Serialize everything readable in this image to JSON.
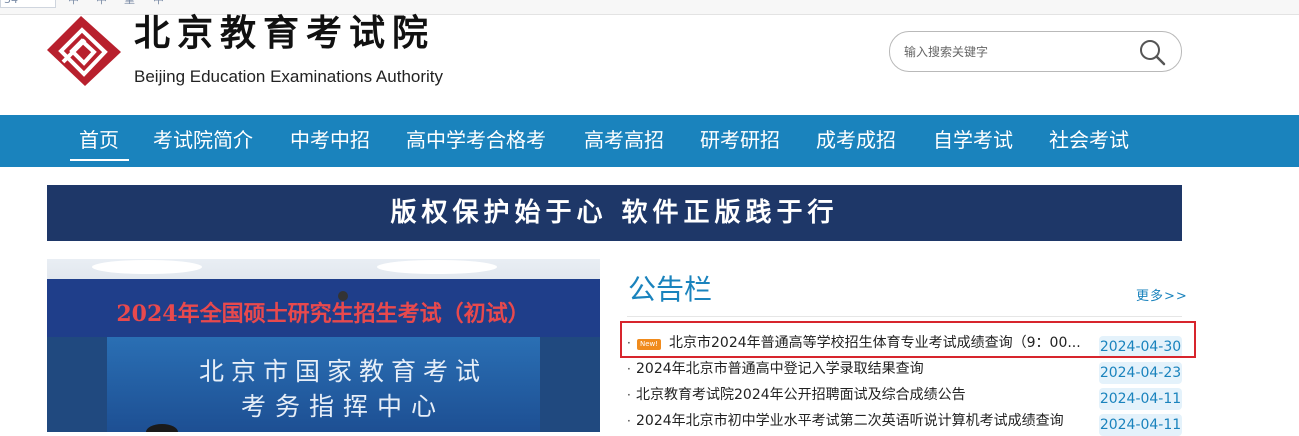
{
  "topbar": {
    "items": [
      "34",
      "中",
      "中",
      "重",
      "中"
    ]
  },
  "header": {
    "org_name_cn": "北京教育考试院",
    "org_name_en": "Beijing Education Examinations Authority",
    "logo_icon": "beaa-logo-icon"
  },
  "search": {
    "placeholder": "输入搜索关键字",
    "value": "",
    "icon": "search-icon"
  },
  "nav": {
    "items": [
      "首页",
      "考试院简介",
      "中考中招",
      "高中学考合格考",
      "高考高招",
      "研考研招",
      "成考成招",
      "自学考试",
      "社会考试"
    ],
    "active_index": 0
  },
  "banner": {
    "text": "版权保护始于心 软件正版践于行"
  },
  "photo": {
    "headline": "2024年全国硕士研究生招生考试（初试）",
    "sign_line1": "北京市国家教育考试",
    "sign_line2": "考务指挥中心"
  },
  "notice": {
    "title": "公告栏",
    "more_label": "更多>>",
    "items": [
      {
        "badge": "New!",
        "title": "北京市2024年普通高等学校招生体育专业考试成绩查询（9：00...",
        "date": "2024-04-30"
      },
      {
        "badge": "",
        "title": "2024年北京市普通高中登记入学录取结果查询",
        "date": "2024-04-23"
      },
      {
        "badge": "",
        "title": "北京教育考试院2024年公开招聘面试及综合成绩公告",
        "date": "2024-04-11"
      },
      {
        "badge": "",
        "title": "2024年北京市初中学业水平考试第二次英语听说计算机考试成绩查询",
        "date": "2024-04-11"
      }
    ]
  },
  "colors": {
    "nav_blue": "#1a83bd",
    "banner_navy": "#1e3768",
    "logo_red": "#b8202d",
    "highlight_red": "#d7252d",
    "badge_orange": "#f08b1d"
  }
}
